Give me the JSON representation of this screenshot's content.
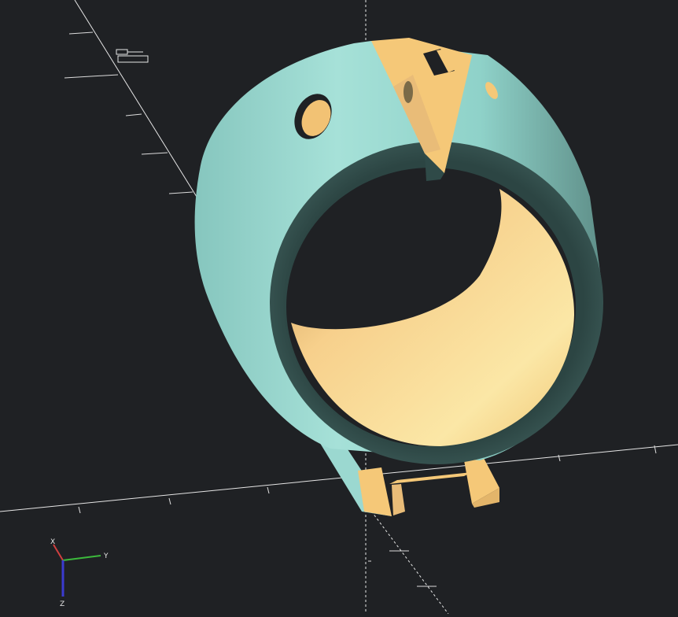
{
  "viewport": {
    "background_color": "#1f2124",
    "model_colors": {
      "outer_surface": "#9bd8d0",
      "inner_surface": "#f5c878",
      "rim_edge": "#2f4a48",
      "backface": "#e9bc78"
    }
  },
  "axis_gizmo": {
    "x_label": "X",
    "y_label": "Y",
    "z_label": "Z",
    "colors": {
      "x": "#d04040",
      "y": "#3cba3c",
      "z": "#3b3bd0"
    }
  }
}
